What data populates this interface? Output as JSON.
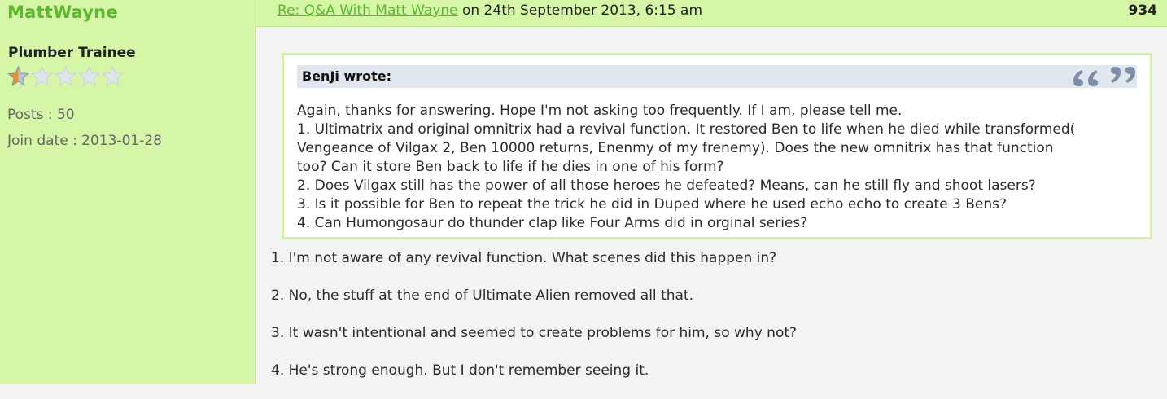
{
  "author": {
    "username": "MattWayne",
    "rank": "Plumber Trainee",
    "rating": {
      "filled": 1,
      "total": 5
    },
    "posts_label": "Posts : 50",
    "join_label": "Join date : 2013-01-28"
  },
  "post": {
    "title_link": "Re: Q&A With Matt Wayne",
    "date_text": " on 24th September 2013, 6:15 am",
    "number": "934"
  },
  "quote": {
    "author_label": "BenJi wrote:",
    "icon": "quote-marks-icon",
    "lines": [
      "Again, thanks for answering. Hope I'm not asking too frequently. If I am, please tell me.",
      "1. Ultimatrix and original omnitrix had a revival function. It restored Ben to life when he died while transformed(",
      "Vengeance of Vilgax 2, Ben 10000 returns, Enenmy of my frenemy). Does the new omnitrix has that function",
      "too? Can it store Ben back to life if he dies in one of his form?",
      "2. Does Vilgax still has the power of all those heroes he defeated? Means, can he still fly and shoot lasers?",
      "3. Is it possible for Ben to repeat the trick he did in Duped where he used echo echo to create 3 Bens?",
      "4. Can Humongosaur do thunder clap like Four Arms did in orginal series?"
    ]
  },
  "answers": [
    "1. I'm not aware of any revival function. What scenes did this happen in?",
    "2. No, the stuff at the end of Ultimate Alien removed all that.",
    "3. It wasn't intentional and seemed to create problems for him, so why not?",
    "4. He's strong enough. But I don't remember seeing it."
  ],
  "colors": {
    "panel_green": "#d5f5a7",
    "link_green": "#5cb82d",
    "quote_bar": "#e1e7ef",
    "star_filled": "#e6932b",
    "star_empty": "#dfe5ec"
  }
}
